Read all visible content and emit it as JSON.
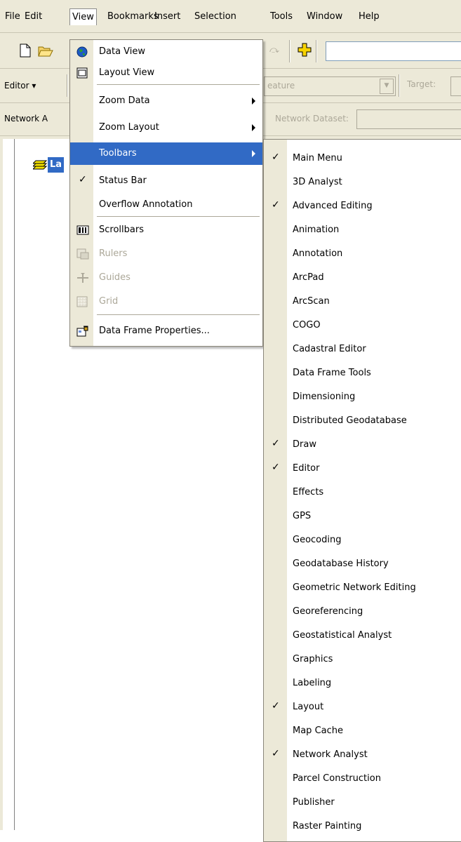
{
  "menubar": {
    "items": [
      {
        "label": "File"
      },
      {
        "label": "Edit"
      },
      {
        "label": "View"
      },
      {
        "label": "Bookmarks"
      },
      {
        "label": "Insert"
      },
      {
        "label": "Selection"
      },
      {
        "label": "Tools"
      },
      {
        "label": "Window"
      },
      {
        "label": "Help"
      }
    ]
  },
  "editor_toolbar": {
    "editor_label": "Editor",
    "task_value": "eature",
    "target_label": "Target:"
  },
  "network_toolbar": {
    "network_label": "Network A",
    "dataset_label": "Network Dataset:"
  },
  "toc": {
    "layers_label": "La"
  },
  "view_menu": {
    "items": [
      {
        "label": "Data View"
      },
      {
        "label": "Layout View"
      },
      {
        "label": "Zoom Data"
      },
      {
        "label": "Zoom Layout"
      },
      {
        "label": "Toolbars"
      },
      {
        "label": "Status Bar",
        "checked": true
      },
      {
        "label": "Overflow Annotation"
      },
      {
        "label": "Scrollbars"
      },
      {
        "label": "Rulers"
      },
      {
        "label": "Guides"
      },
      {
        "label": "Grid"
      },
      {
        "label": "Data Frame Properties..."
      }
    ]
  },
  "toolbars_submenu": {
    "items": [
      {
        "label": "Main Menu",
        "checked": true
      },
      {
        "label": "3D Analyst",
        "checked": false
      },
      {
        "label": "Advanced Editing",
        "checked": true
      },
      {
        "label": "Animation",
        "checked": false
      },
      {
        "label": "Annotation",
        "checked": false
      },
      {
        "label": "ArcPad",
        "checked": false
      },
      {
        "label": "ArcScan",
        "checked": false
      },
      {
        "label": "COGO",
        "checked": false
      },
      {
        "label": "Cadastral Editor",
        "checked": false
      },
      {
        "label": "Data Frame Tools",
        "checked": false
      },
      {
        "label": "Dimensioning",
        "checked": false
      },
      {
        "label": "Distributed Geodatabase",
        "checked": false
      },
      {
        "label": "Draw",
        "checked": true
      },
      {
        "label": "Editor",
        "checked": true
      },
      {
        "label": "Effects",
        "checked": false
      },
      {
        "label": "GPS",
        "checked": false
      },
      {
        "label": "Geocoding",
        "checked": false
      },
      {
        "label": "Geodatabase History",
        "checked": false
      },
      {
        "label": "Geometric Network Editing",
        "checked": false
      },
      {
        "label": "Georeferencing",
        "checked": false
      },
      {
        "label": "Geostatistical Analyst",
        "checked": false
      },
      {
        "label": "Graphics",
        "checked": false
      },
      {
        "label": "Labeling",
        "checked": false
      },
      {
        "label": "Layout",
        "checked": true
      },
      {
        "label": "Map Cache",
        "checked": false
      },
      {
        "label": "Network Analyst",
        "checked": true
      },
      {
        "label": "Parcel Construction",
        "checked": false
      },
      {
        "label": "Publisher",
        "checked": false
      },
      {
        "label": "Raster Painting",
        "checked": false
      }
    ]
  },
  "check_glyph": "✓",
  "colors": {
    "highlight": "#316ac5",
    "chrome": "#ece9d8",
    "disabled_text": "#aca899"
  }
}
